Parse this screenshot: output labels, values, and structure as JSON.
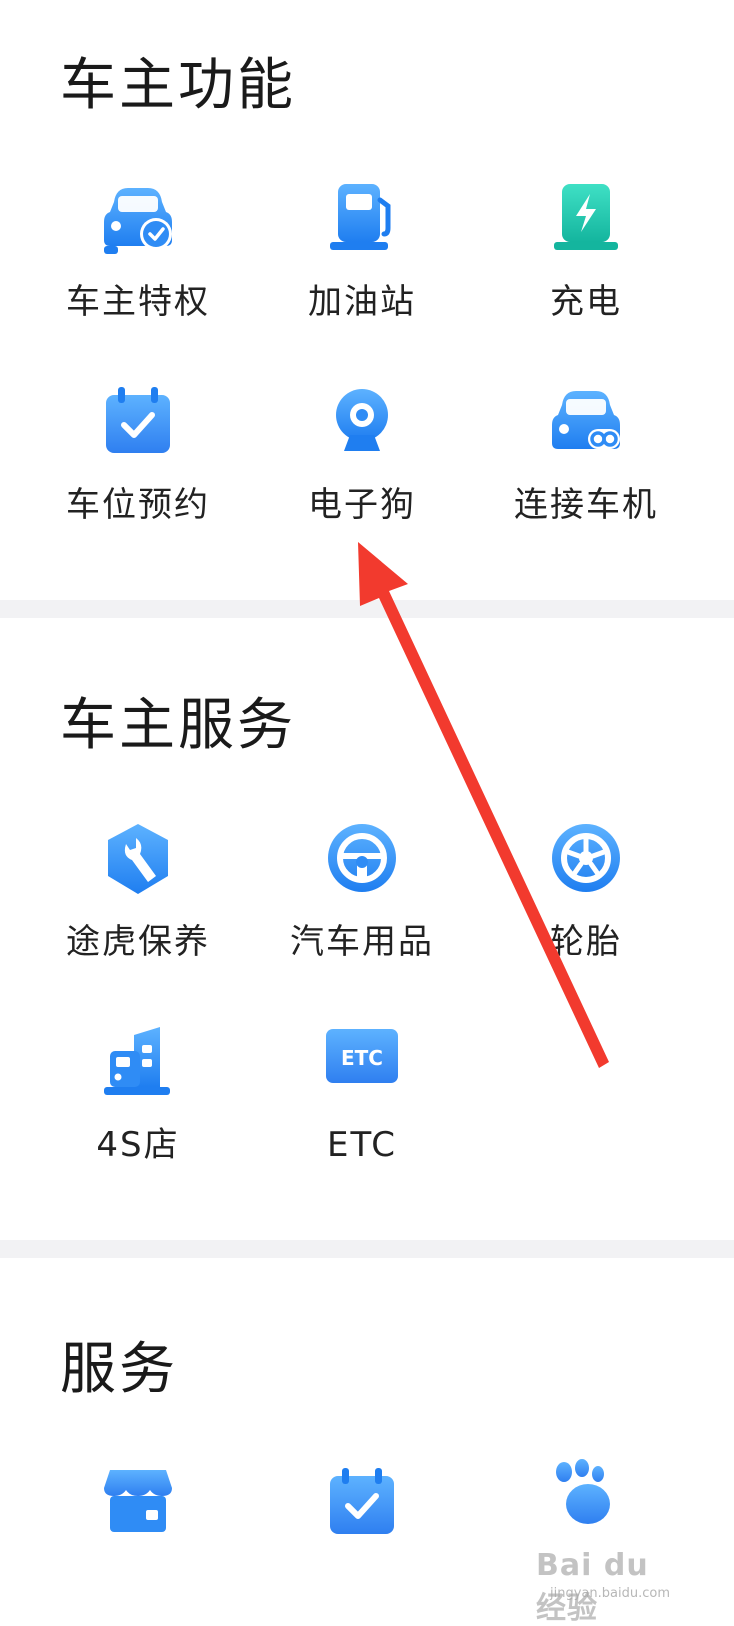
{
  "sections": [
    {
      "title": "车主功能",
      "items": [
        {
          "label": "车主特权",
          "icon": "car-check-icon"
        },
        {
          "label": "加油站",
          "icon": "fuel-pump-icon"
        },
        {
          "label": "充电",
          "icon": "charging-icon"
        },
        {
          "label": "车位预约",
          "icon": "calendar-check-icon"
        },
        {
          "label": "电子狗",
          "icon": "camera-icon"
        },
        {
          "label": "连接车机",
          "icon": "car-link-icon"
        }
      ]
    },
    {
      "title": "车主服务",
      "items": [
        {
          "label": "途虎保养",
          "icon": "wrench-icon"
        },
        {
          "label": "汽车用品",
          "icon": "steering-wheel-icon"
        },
        {
          "label": "轮胎",
          "icon": "tire-icon"
        },
        {
          "label": "4S店",
          "icon": "building-icon"
        },
        {
          "label": "ETC",
          "icon": "etc-card-icon"
        }
      ]
    },
    {
      "title": "服务",
      "items": [
        {
          "label": "",
          "icon": "store-icon"
        },
        {
          "label": "",
          "icon": "calendar-check-icon"
        },
        {
          "label": "",
          "icon": "paw-icon"
        }
      ]
    }
  ],
  "etc_icon_text": "ETC",
  "watermark": {
    "main": "Bai du 经验",
    "sub": "jingyan.baidu.com"
  },
  "colors": {
    "icon_blue": "#2f8cf5",
    "icon_blue_light": "#5db2ff",
    "icon_teal": "#1fc8b0",
    "arrow_red": "#f23a2e",
    "divider": "#f2f2f4"
  }
}
